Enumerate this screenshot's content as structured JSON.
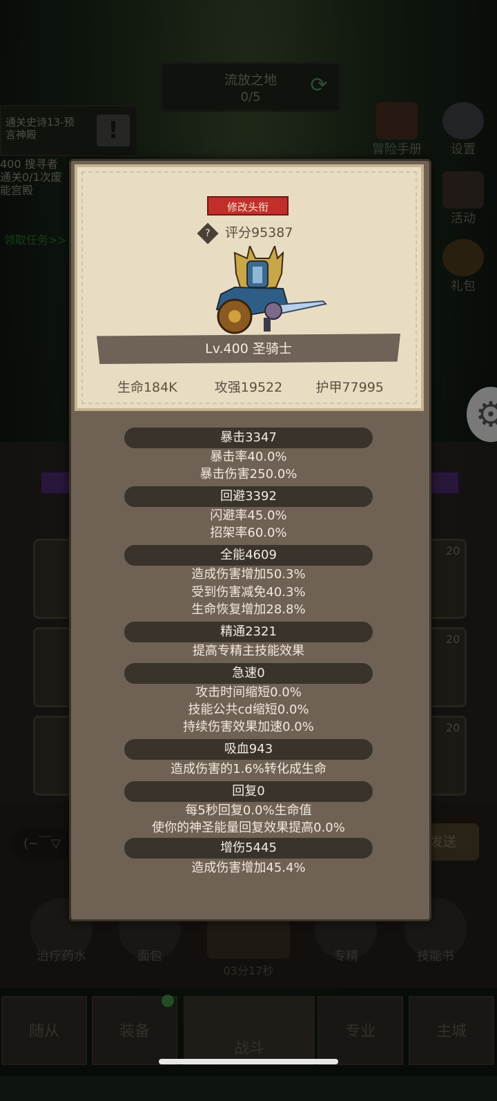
{
  "stage": {
    "name": "流放之地",
    "progress": "0/5"
  },
  "quest": {
    "text": "通关史诗13-预言神殿",
    "seekers": "400 搜寻者",
    "sub1": "通关0/1次废",
    "sub2": "能宫殿",
    "claim": "领取任务>>"
  },
  "side": {
    "guide": "冒险手册",
    "settings": "设置",
    "activity": "活动",
    "gift": "礼包"
  },
  "profile": {
    "rename_label": "修改头衔",
    "score": "评分95387",
    "class_line": "Lv.400 圣骑士",
    "hp": "生命184K",
    "attack": "攻强19522",
    "armor": "护甲77995"
  },
  "attributes": {
    "crit": {
      "head": "暴击3347",
      "l1": "暴击率40.0%",
      "l2": "暴击伤害250.0%"
    },
    "avoid": {
      "head": "回避3392",
      "l1": "闪避率45.0%",
      "l2": "招架率60.0%"
    },
    "versatility": {
      "head": "全能4609",
      "l1": "造成伤害增加50.3%",
      "l2": "受到伤害减免40.3%",
      "l3": "生命恢复增加28.8%"
    },
    "mastery": {
      "head": "精通2321",
      "l1": "提高专精主技能效果"
    },
    "haste": {
      "head": "急速0",
      "l1": "攻击时间缩短0.0%",
      "l2": "技能公共cd缩短0.0%",
      "l3": "持续伤害效果加速0.0%"
    },
    "leech": {
      "head": "吸血943",
      "l1": "造成伤害的1.6%转化成生命"
    },
    "regen": {
      "head": "回复0",
      "l1": "每5秒回复0.0%生命值",
      "l2": "使你的神圣能量回复效果提高0.0%"
    },
    "dmgup": {
      "head": "增伤5445",
      "l1": "造成伤害增加45.4%"
    }
  },
  "slots": {
    "level": "20"
  },
  "chat": {
    "emote": "(~￣▽",
    "send": "发送"
  },
  "tools": {
    "potion": "治疗药水",
    "bread": "面包",
    "spec": "专精",
    "skillbook": "技能书",
    "timer": "03分17秒"
  },
  "tabs": {
    "follower": "随从",
    "gear": "装备",
    "battle": "战斗",
    "profession": "专业",
    "city": "主城"
  }
}
